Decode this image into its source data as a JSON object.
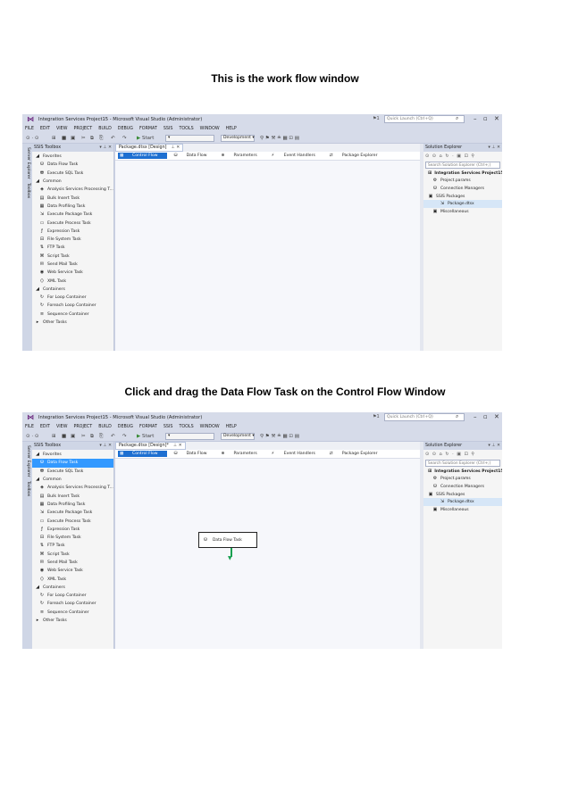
{
  "heading1": "This is the work flow window",
  "heading2": "Click and drag the Data Flow Task on the Control Flow Window",
  "vs": {
    "title": "Integration Services Project15 - Microsoft Visual Studio (Administrator)",
    "notif_count": "1",
    "quick_launch_placeholder": "Quick Launch (Ctrl+Q)",
    "menu": [
      "FILE",
      "EDIT",
      "VIEW",
      "PROJECT",
      "BUILD",
      "DEBUG",
      "FORMAT",
      "SSIS",
      "TOOLS",
      "WINDOW",
      "HELP"
    ],
    "start_label": "Start",
    "config": "Development",
    "side_tabs": [
      "Server Explorer",
      "Toolbox"
    ],
    "toolbox_title": "SSIS Toolbox",
    "doc_tab_1": "Package.dtsx [Design]",
    "doc_tab_2": "Package.dtsx [Design]*",
    "design_tabs": [
      "Control Flow",
      "Data Flow",
      "Parameters",
      "Event Handlers",
      "Package Explorer"
    ],
    "solution_title": "Solution Explorer",
    "solution_search": "Search Solution Explorer (Ctrl+;)",
    "solution_tree": [
      "Integration Services Project15",
      "Project.params",
      "Connection Managers",
      "SSIS Packages",
      "Package.dtsx",
      "Miscellaneous"
    ],
    "canvas_task": "Data Flow Task"
  },
  "toolbox": [
    {
      "label": "Favorites",
      "kind": "group",
      "icon": "collapse-triangle-icon"
    },
    {
      "label": "Data Flow Task",
      "kind": "item",
      "icon": "data-flow-task-icon"
    },
    {
      "label": "Execute SQL Task",
      "kind": "item",
      "icon": "execute-sql-icon"
    },
    {
      "label": "Common",
      "kind": "group",
      "icon": "collapse-triangle-icon"
    },
    {
      "label": "Analysis Services Processing T...",
      "kind": "item",
      "icon": "cube-icon"
    },
    {
      "label": "Bulk Insert Task",
      "kind": "item",
      "icon": "bulk-insert-icon"
    },
    {
      "label": "Data Profiling Task",
      "kind": "item",
      "icon": "profiling-icon"
    },
    {
      "label": "Execute Package Task",
      "kind": "item",
      "icon": "package-icon"
    },
    {
      "label": "Execute Process Task",
      "kind": "item",
      "icon": "process-icon"
    },
    {
      "label": "Expression Task",
      "kind": "item",
      "icon": "fx-icon"
    },
    {
      "label": "File System Task",
      "kind": "item",
      "icon": "file-icon"
    },
    {
      "label": "FTP Task",
      "kind": "item",
      "icon": "ftp-icon"
    },
    {
      "label": "Script Task",
      "kind": "item",
      "icon": "script-icon"
    },
    {
      "label": "Send Mail Task",
      "kind": "item",
      "icon": "mail-icon"
    },
    {
      "label": "Web Service Task",
      "kind": "item",
      "icon": "globe-icon"
    },
    {
      "label": "XML Task",
      "kind": "item",
      "icon": "xml-icon"
    },
    {
      "label": "Containers",
      "kind": "group",
      "icon": "collapse-triangle-icon"
    },
    {
      "label": "For Loop Container",
      "kind": "item",
      "icon": "loop-icon"
    },
    {
      "label": "Foreach Loop Container",
      "kind": "item",
      "icon": "loop-icon"
    },
    {
      "label": "Sequence Container",
      "kind": "item",
      "icon": "sequence-icon"
    },
    {
      "label": "Other Tasks",
      "kind": "group",
      "icon": "expand-triangle-icon"
    }
  ]
}
